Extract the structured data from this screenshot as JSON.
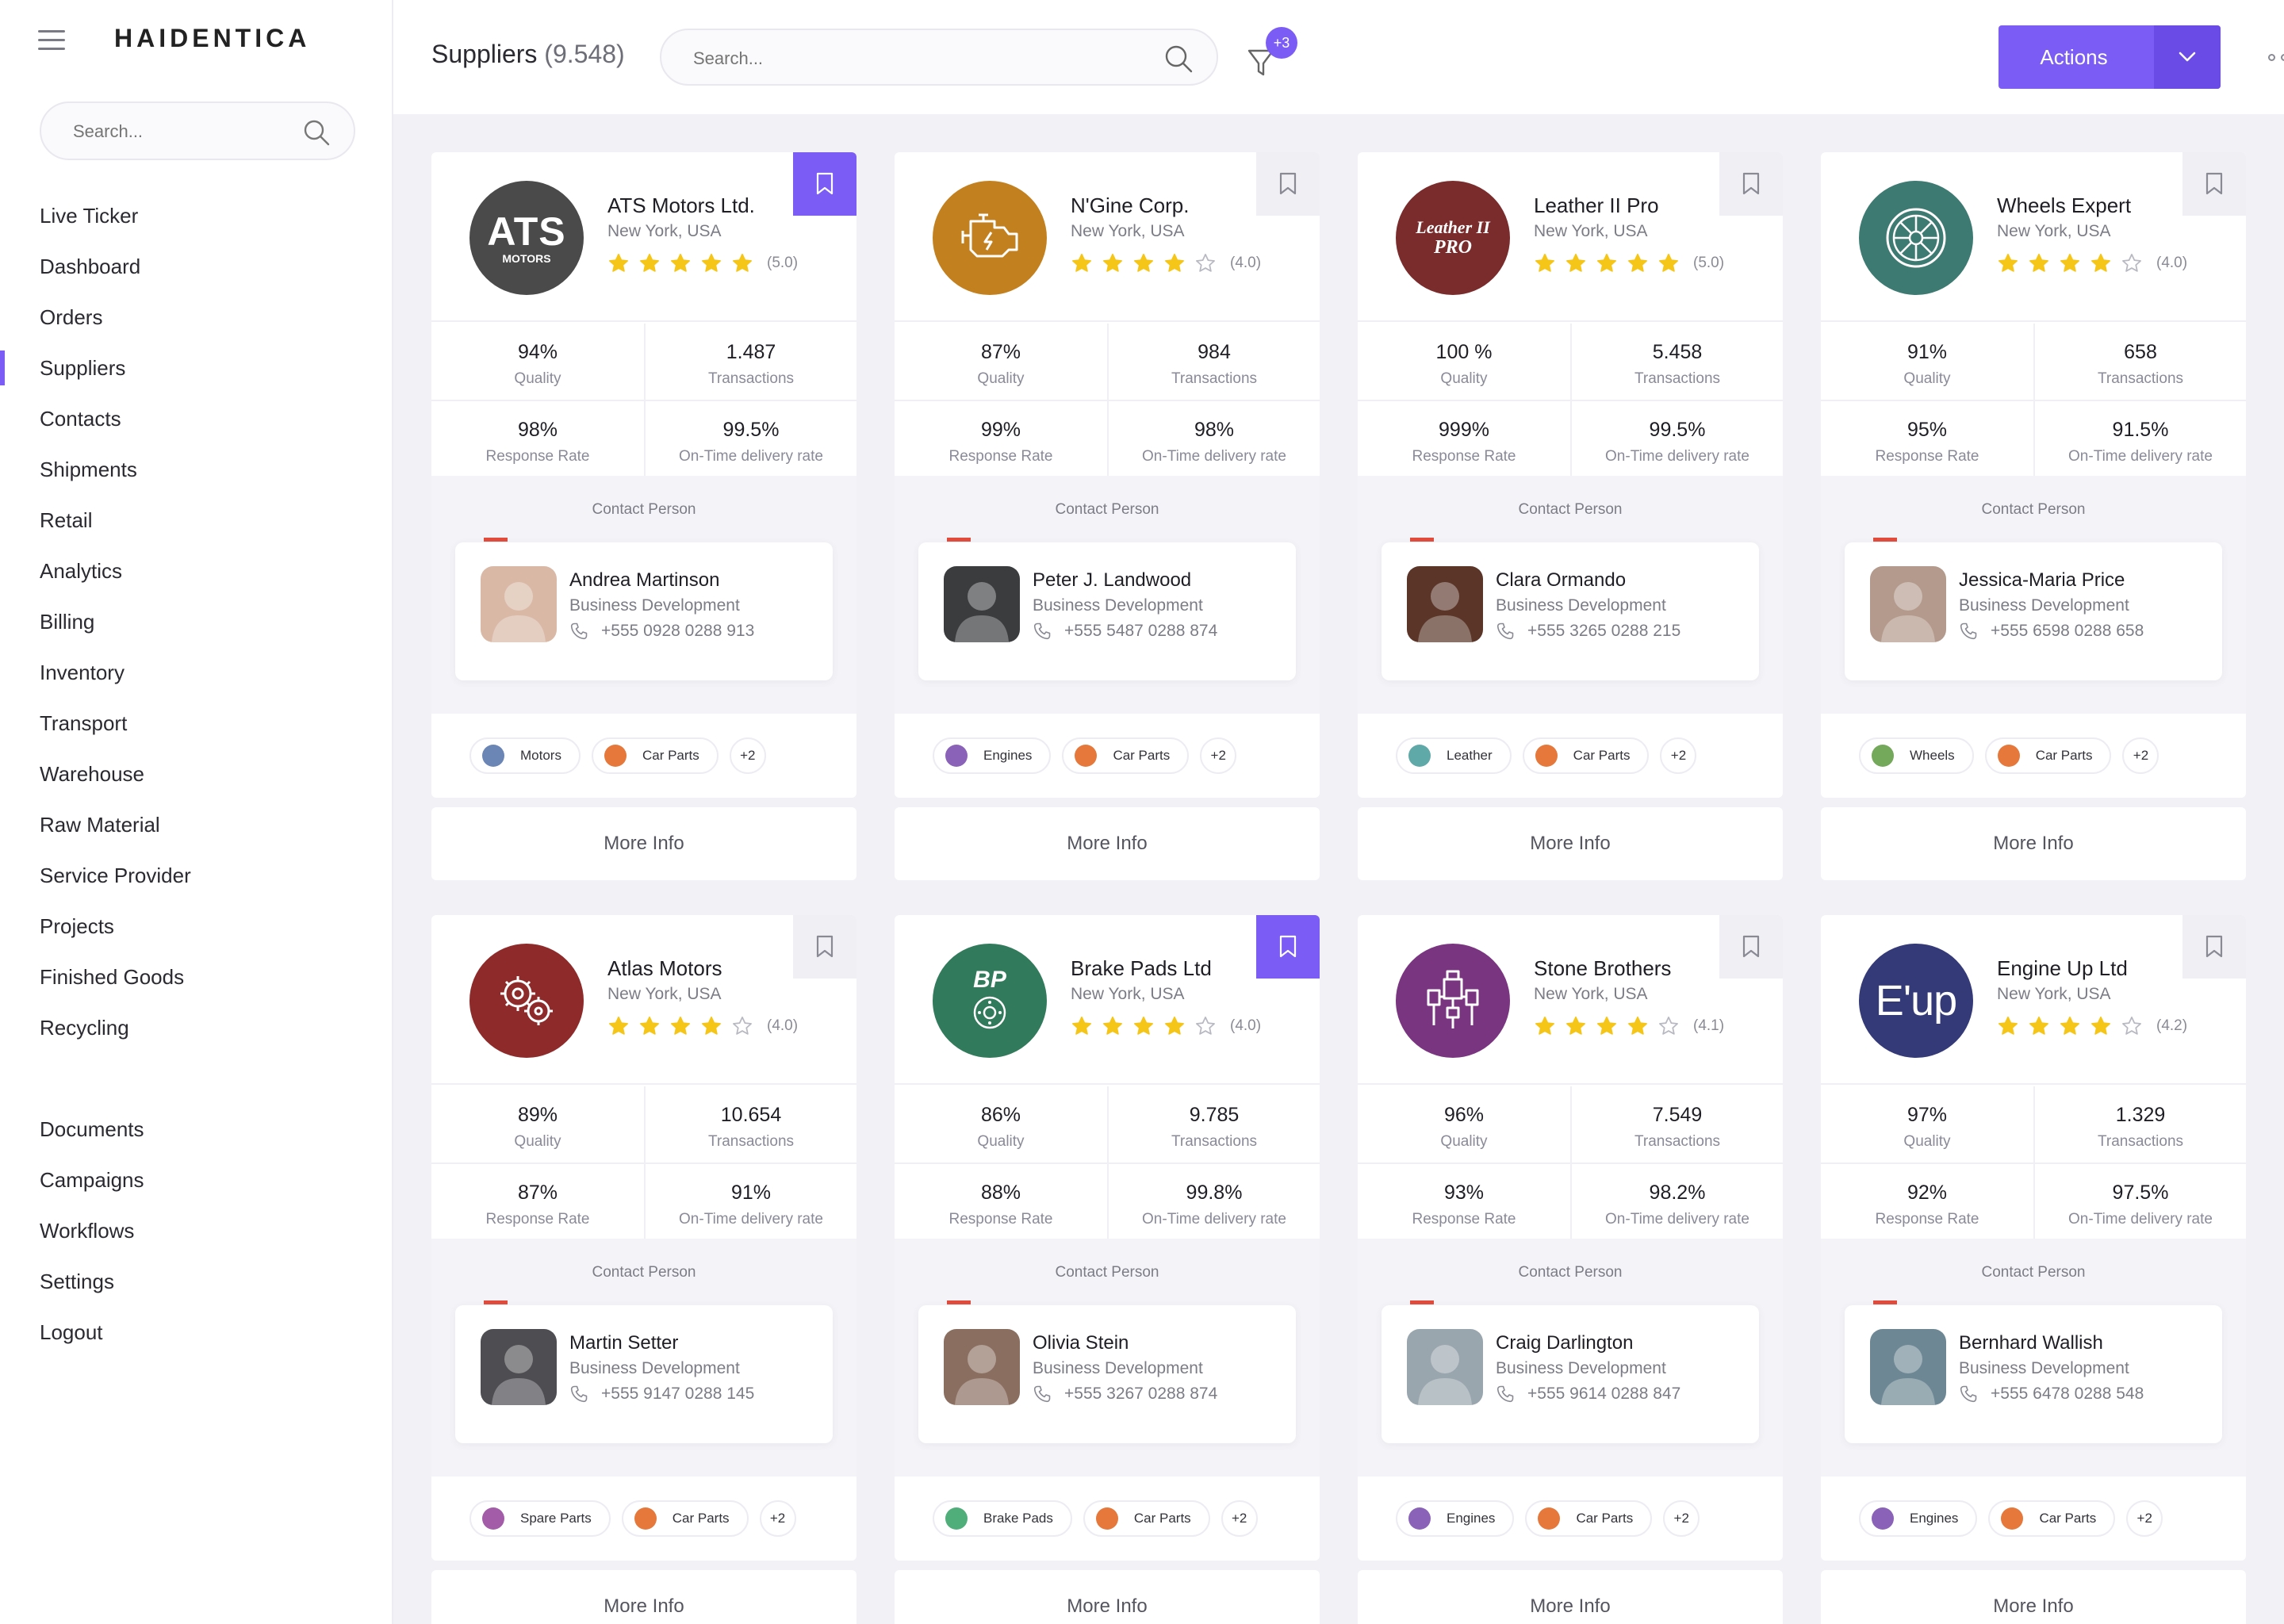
{
  "brand": "HAIDENTICA",
  "sidebar": {
    "search_placeholder": "Search...",
    "items": [
      "Live Ticker",
      "Dashboard",
      "Orders",
      "Suppliers",
      "Contacts",
      "Shipments",
      "Retail",
      "Analytics",
      "Billing",
      "Inventory",
      "Transport",
      "Warehouse",
      "Raw Material",
      "Service Provider",
      "Projects",
      "Finished Goods",
      "Recycling"
    ],
    "items2": [
      "Documents",
      "Campaigns",
      "Workflows",
      "Settings",
      "Logout"
    ],
    "active": "Suppliers"
  },
  "header": {
    "title": "Suppliers",
    "count": "(9.548)",
    "search_placeholder": "Search...",
    "filter_badge": "+3",
    "actions_label": "Actions"
  },
  "labels": {
    "quality": "Quality",
    "transactions": "Transactions",
    "response": "Response Rate",
    "ontime": "On-Time delivery rate",
    "contact": "Contact Person",
    "more_info": "More Info",
    "tag_more": "+2"
  },
  "colors": {
    "accent": "#7b5cf5",
    "star": "#f5c518",
    "red_mark": "#e04b3c"
  },
  "cards": [
    {
      "name": "ATS Motors Ltd.",
      "loc": "New York, USA",
      "stars": 5,
      "score": "(5.0)",
      "logo_bg": "#4a4a4a",
      "logo_text": "ATS",
      "logo_sub": "MOTORS",
      "bookmarked": true,
      "quality": "94%",
      "transactions": "1.487",
      "response": "98%",
      "ontime": "99.5%",
      "person": {
        "name": "Andrea Martinson",
        "role": "Business Development",
        "phone": "+555 0928 0288 913",
        "photo_bg": "#d9b8a6"
      },
      "tags": [
        {
          "label": "Motors",
          "color": "#6b86b5"
        },
        {
          "label": "Car Parts",
          "color": "#e5783a"
        }
      ]
    },
    {
      "name": "N'Gine Corp.",
      "loc": "New York, USA",
      "stars": 4,
      "score": "(4.0)",
      "logo_bg": "#c3801f",
      "logo_text": "",
      "logo_sub": "",
      "bookmarked": false,
      "quality": "87%",
      "transactions": "984",
      "response": "99%",
      "ontime": "98%",
      "person": {
        "name": "Peter J. Landwood",
        "role": "Business Development",
        "phone": "+555 5487 0288 874",
        "photo_bg": "#3a3c3e"
      },
      "tags": [
        {
          "label": "Engines",
          "color": "#8a63b8"
        },
        {
          "label": "Car Parts",
          "color": "#e5783a"
        }
      ]
    },
    {
      "name": "Leather II Pro",
      "loc": "New York, USA",
      "stars": 5,
      "score": "(5.0)",
      "logo_bg": "#7a2c2c",
      "logo_text": "Leather II",
      "logo_sub": "PRO",
      "bookmarked": false,
      "quality": "100 %",
      "transactions": "5.458",
      "response": "999%",
      "ontime": "99.5%",
      "person": {
        "name": "Clara Ormando",
        "role": "Business Development",
        "phone": "+555 3265 0288 215",
        "photo_bg": "#5a3528"
      },
      "tags": [
        {
          "label": "Leather",
          "color": "#5fa9a8"
        },
        {
          "label": "Car Parts",
          "color": "#e5783a"
        }
      ]
    },
    {
      "name": "Wheels Expert",
      "loc": "New York, USA",
      "stars": 4,
      "score": "(4.0)",
      "logo_bg": "#3d7a72",
      "logo_text": "",
      "logo_sub": "",
      "bookmarked": false,
      "quality": "91%",
      "transactions": "658",
      "response": "95%",
      "ontime": "91.5%",
      "person": {
        "name": "Jessica-Maria Price",
        "role": "Business Development",
        "phone": "+555 6598 0288 658",
        "photo_bg": "#b39a8c"
      },
      "tags": [
        {
          "label": "Wheels",
          "color": "#74a85a"
        },
        {
          "label": "Car Parts",
          "color": "#e5783a"
        }
      ]
    },
    {
      "name": "Atlas Motors",
      "loc": "New York, USA",
      "stars": 4,
      "score": "(4.0)",
      "logo_bg": "#8e2a2a",
      "logo_text": "",
      "logo_sub": "",
      "bookmarked": false,
      "quality": "89%",
      "transactions": "10.654",
      "response": "87%",
      "ontime": "91%",
      "person": {
        "name": "Martin Setter",
        "role": "Business Development",
        "phone": "+555 9147 0288 145",
        "photo_bg": "#4d4d52"
      },
      "tags": [
        {
          "label": "Spare Parts",
          "color": "#a35ca8"
        },
        {
          "label": "Car Parts",
          "color": "#e5783a"
        }
      ]
    },
    {
      "name": "Brake Pads Ltd",
      "loc": "New York, USA",
      "stars": 4,
      "score": "(4.0)",
      "logo_bg": "#327a5c",
      "logo_text": "BP",
      "logo_sub": "",
      "bookmarked": true,
      "quality": "86%",
      "transactions": "9.785",
      "response": "88%",
      "ontime": "99.8%",
      "person": {
        "name": "Olivia Stein",
        "role": "Business Development",
        "phone": "+555 3267 0288 874",
        "photo_bg": "#8a6e60"
      },
      "tags": [
        {
          "label": "Brake Pads",
          "color": "#4fae7a"
        },
        {
          "label": "Car Parts",
          "color": "#e5783a"
        }
      ]
    },
    {
      "name": "Stone Brothers",
      "loc": "New York, USA",
      "stars": 4,
      "score": "(4.1)",
      "logo_bg": "#7a3580",
      "logo_text": "",
      "logo_sub": "",
      "bookmarked": false,
      "quality": "96%",
      "transactions": "7.549",
      "response": "93%",
      "ontime": "98.2%",
      "person": {
        "name": "Craig Darlington",
        "role": "Business Development",
        "phone": "+555 9614 0288 847",
        "photo_bg": "#9aa6ae"
      },
      "tags": [
        {
          "label": "Engines",
          "color": "#8a63b8"
        },
        {
          "label": "Car Parts",
          "color": "#e5783a"
        }
      ]
    },
    {
      "name": "Engine Up Ltd",
      "loc": "New York, USA",
      "stars": 4,
      "score": "(4.2)",
      "logo_bg": "#343a78",
      "logo_text": "E'up",
      "logo_sub": "",
      "bookmarked": false,
      "quality": "97%",
      "transactions": "1.329",
      "response": "92%",
      "ontime": "97.5%",
      "person": {
        "name": "Bernhard Wallish",
        "role": "Business Development",
        "phone": "+555 6478 0288 548",
        "photo_bg": "#6d8894"
      },
      "tags": [
        {
          "label": "Engines",
          "color": "#8a63b8"
        },
        {
          "label": "Car Parts",
          "color": "#e5783a"
        }
      ]
    }
  ]
}
